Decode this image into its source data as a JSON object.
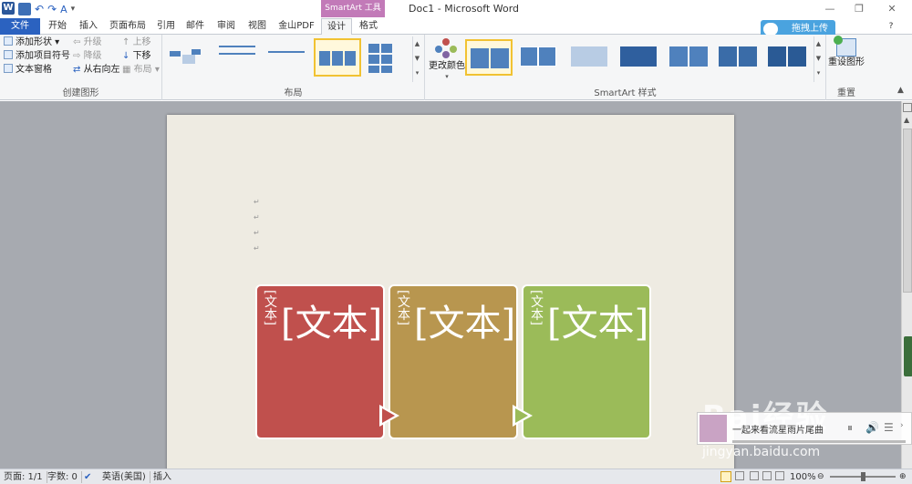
{
  "window": {
    "title": "Doc1 - Microsoft Word",
    "contextual_tools_label": "SmartArt 工具",
    "minimize": "—",
    "maximize": "❐",
    "close": "✕"
  },
  "qat": {
    "word_letter": "W",
    "undo": "↶",
    "redo": "↷",
    "customize": "▾"
  },
  "tabs": [
    {
      "label": "文件"
    },
    {
      "label": "开始"
    },
    {
      "label": "插入"
    },
    {
      "label": "页面布局"
    },
    {
      "label": "引用"
    },
    {
      "label": "邮件"
    },
    {
      "label": "审阅"
    },
    {
      "label": "视图"
    },
    {
      "label": "金山PDF"
    },
    {
      "label": "设计"
    },
    {
      "label": "格式"
    }
  ],
  "upload_button": {
    "label": "拖拽上传"
  },
  "ribbon": {
    "create_graphic": {
      "label": "创建图形",
      "add_shape": "添加形状",
      "add_bullet": "添加项目符号",
      "text_pane": "文本窗格",
      "promote": "升级",
      "demote": "降级",
      "right_to_left": "从右向左",
      "move_up": "上移",
      "move_down": "下移",
      "layout": "布局"
    },
    "layouts": {
      "label": "布局"
    },
    "smartart_styles": {
      "label": "SmartArt 样式",
      "change_colors": "更改颜色"
    },
    "reset": {
      "label": "重置",
      "reset_graphic": "重设图形"
    }
  },
  "document": {
    "paragraph_mark": "↵",
    "smartart": {
      "cards": [
        {
          "vertical_text": "[文本]",
          "big_text": "[文本]",
          "color": "#c0504d"
        },
        {
          "vertical_text": "[文本]",
          "big_text": "[文本]",
          "color": "#b8964f"
        },
        {
          "vertical_text": "[文本]",
          "big_text": "[文本]",
          "color": "#9bbb59"
        }
      ]
    }
  },
  "watermark": {
    "logo": "Bai经验",
    "url": "jingyan.baidu.com"
  },
  "player": {
    "title": "一起来看流星雨片尾曲"
  },
  "statusbar": {
    "page": "页面: 1/1",
    "words": "字数: 0",
    "language": "英语(美国)",
    "mode": "插入",
    "zoom": "100%"
  },
  "colors": {
    "file_tab": "#2b62c0",
    "smartart_tools": "#c27ab8",
    "accent_blue": "#4f81bd"
  }
}
